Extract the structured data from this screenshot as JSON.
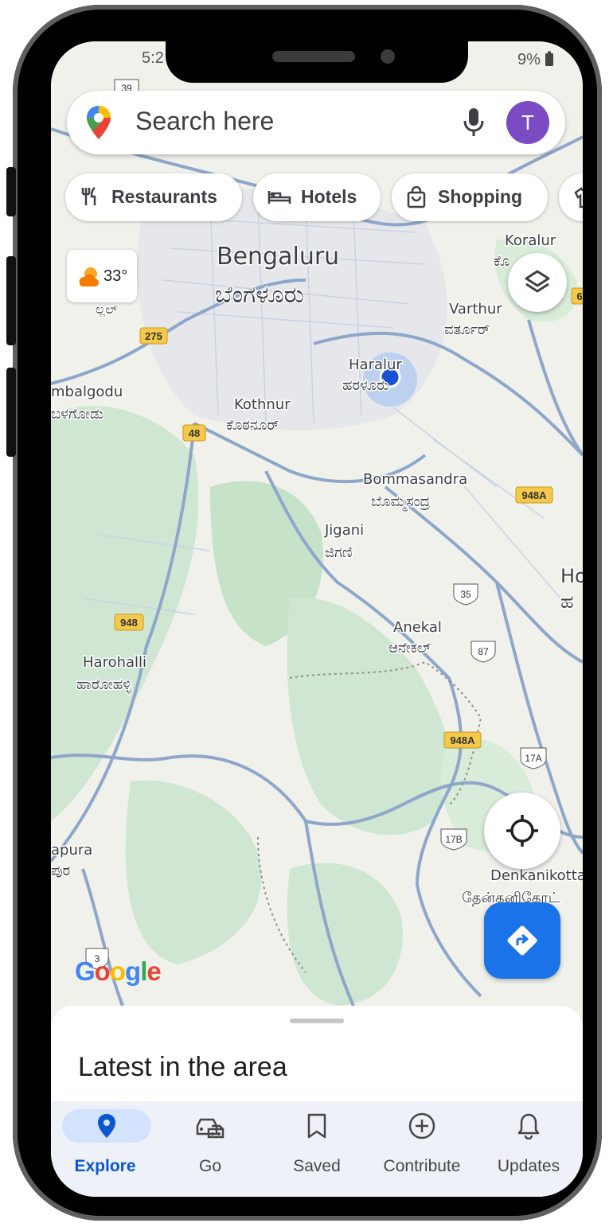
{
  "status": {
    "time": "5:2",
    "battery": "9%"
  },
  "search": {
    "placeholder": "Search here",
    "avatar_letter": "T"
  },
  "chips": [
    {
      "label": "Restaurants",
      "icon": "cutlery-icon"
    },
    {
      "label": "Hotels",
      "icon": "bed-icon"
    },
    {
      "label": "Shopping",
      "icon": "shopping-bag-icon"
    },
    {
      "label": "",
      "icon": "shirt-icon"
    }
  ],
  "weather": {
    "temp": "33°",
    "icon": "partly-cloudy-icon"
  },
  "map": {
    "places": [
      {
        "name": "Bengaluru",
        "local": "ಬೆಂಗಳೂರು"
      },
      {
        "name": "Koralur",
        "local": "ಕೊ"
      },
      {
        "name": "Varthur",
        "local": "ವರ್ತೂರ್"
      },
      {
        "name": "Haralur",
        "local": "ಹರಳೂರು"
      },
      {
        "name": "mbalgodu",
        "local": "ಬಳಗೋಡು"
      },
      {
        "name": "Kothnur",
        "local": "ಕೊಠನೂರ್"
      },
      {
        "name": "Bommasandra",
        "local": "ಬೊಮ್ಮಸಂದ್ರ"
      },
      {
        "name": "Jigani",
        "local": "ಜಿಗಣಿ"
      },
      {
        "name": "Anekal",
        "local": "ಆನೇಕಲ್"
      },
      {
        "name": "Harohalli",
        "local": "ಹಾರೋಹಳ್ಳಿ"
      },
      {
        "name": "apura",
        "local": "ಪುರ"
      },
      {
        "name": "Denkanikotta",
        "local": "தேன்கனிகோட்"
      },
      {
        "name": "Ho",
        "local": "ಹ"
      },
      {
        "name": "",
        "local": "ಲ್ಲಲ್"
      }
    ],
    "highway_shields": [
      "275",
      "48",
      "948",
      "948A",
      "948A",
      "6"
    ],
    "route_shields": [
      "39",
      "35",
      "87",
      "17A",
      "17B",
      "3"
    ],
    "google_logo": "Google"
  },
  "sheet": {
    "title": "Latest in the area"
  },
  "nav": [
    {
      "label": "Explore",
      "icon": "explore-pin-icon",
      "active": true
    },
    {
      "label": "Go",
      "icon": "car-icon",
      "active": false
    },
    {
      "label": "Saved",
      "icon": "bookmark-icon",
      "active": false
    },
    {
      "label": "Contribute",
      "icon": "add-circle-icon",
      "active": false
    },
    {
      "label": "Updates",
      "icon": "bell-icon",
      "active": false
    }
  ],
  "colors": {
    "accent": "#1a73e8",
    "avatar": "#7b4bc4",
    "park": "#cfe7d2",
    "road": "#8ea6c9",
    "highway": "#f4c84a",
    "nav_active": "#d3e3fd"
  }
}
